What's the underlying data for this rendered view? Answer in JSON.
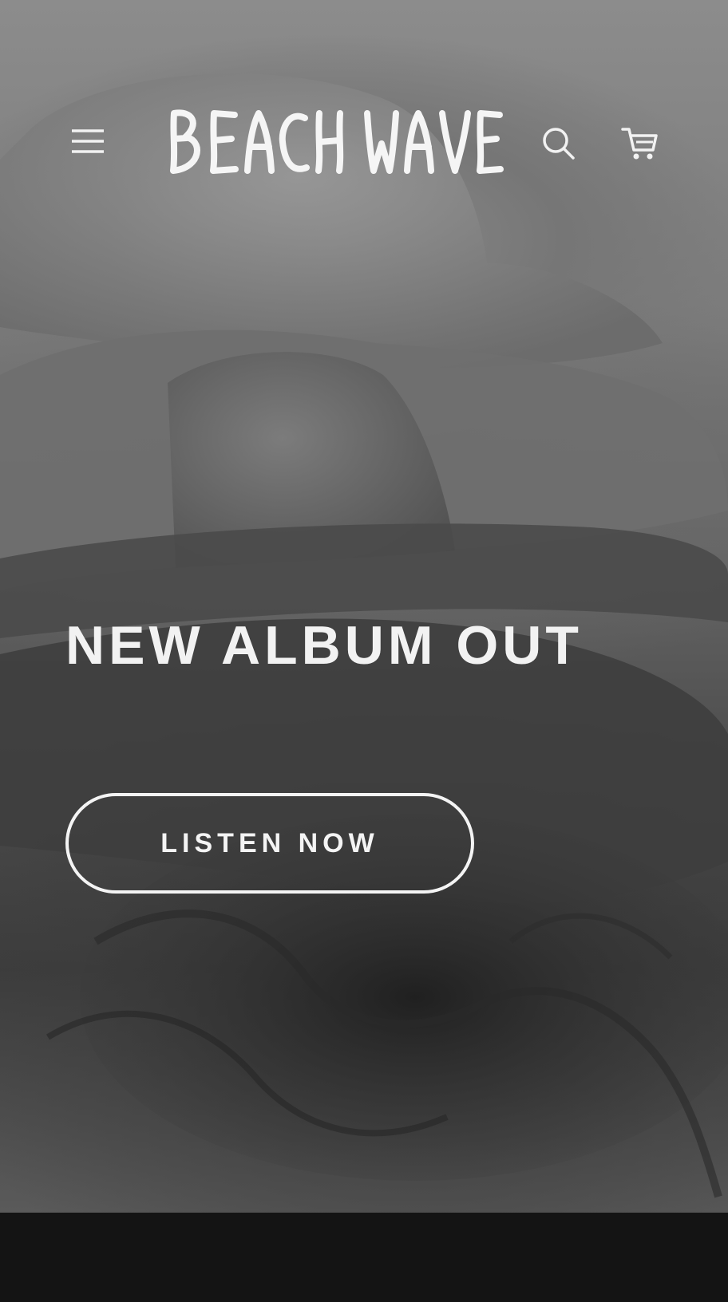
{
  "header": {
    "logo_text": "BEACH WAVE",
    "menu_icon": "hamburger-menu-icon",
    "search_icon": "search-icon",
    "cart_icon": "cart-icon"
  },
  "hero": {
    "headline": "NEW ALBUM OUT",
    "cta_label": "LISTEN NOW",
    "image_description_icon": "hero-image"
  },
  "colors": {
    "text": "#f2f2f2",
    "footer_background": "#141414"
  }
}
